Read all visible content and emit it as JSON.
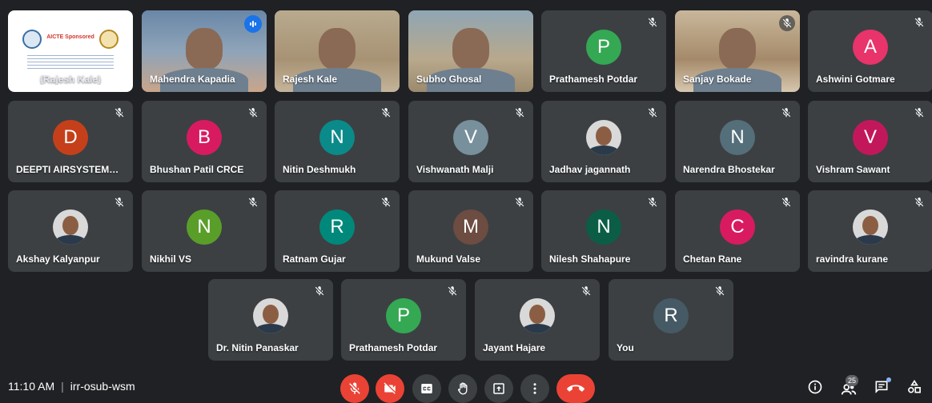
{
  "colors": {
    "accent": "#8ab4f8",
    "danger": "#ea4335",
    "tile": "#3c4043",
    "background": "#202124"
  },
  "participants": [
    {
      "name": "(Rajesh Kale)",
      "kind": "presentation",
      "presentation": {
        "line1": "AICTE Sponsored"
      }
    },
    {
      "name": "Mahendra Kapadia",
      "kind": "video",
      "speaking": true
    },
    {
      "name": "Rajesh Kale",
      "kind": "video"
    },
    {
      "name": "Subho Ghosal",
      "kind": "video"
    },
    {
      "name": "Prathamesh Potdar",
      "kind": "initial",
      "initial": "P",
      "color": "#34a853",
      "muted": true
    },
    {
      "name": "Sanjay Bokade",
      "kind": "video",
      "muted": true
    },
    {
      "name": "Ashwini Gotmare",
      "kind": "initial",
      "initial": "A",
      "color": "#e8336b",
      "muted": true
    },
    {
      "name": "DEEPTI AIRSYSTEMS P...",
      "kind": "initial",
      "initial": "D",
      "color": "#c5401a",
      "muted": true
    },
    {
      "name": "Bhushan Patil CRCE",
      "kind": "initial",
      "initial": "B",
      "color": "#d81b60",
      "muted": true
    },
    {
      "name": "Nitin Deshmukh",
      "kind": "initial",
      "initial": "N",
      "color": "#0b8a8a",
      "muted": true
    },
    {
      "name": "Vishwanath Malji",
      "kind": "initial",
      "initial": "V",
      "color": "#78909c",
      "muted": true
    },
    {
      "name": "Jadhav jagannath",
      "kind": "photo",
      "muted": true
    },
    {
      "name": "Narendra Bhostekar",
      "kind": "initial",
      "initial": "N",
      "color": "#546e7a",
      "muted": true
    },
    {
      "name": "Vishram Sawant",
      "kind": "initial",
      "initial": "V",
      "color": "#c2185b",
      "muted": true
    },
    {
      "name": "Akshay Kalyanpur",
      "kind": "photo",
      "muted": true
    },
    {
      "name": "Nikhil VS",
      "kind": "initial",
      "initial": "N",
      "color": "#5a9e2a",
      "muted": true
    },
    {
      "name": "Ratnam Gujar",
      "kind": "initial",
      "initial": "R",
      "color": "#00897b",
      "muted": true
    },
    {
      "name": "Mukund Valse",
      "kind": "initial",
      "initial": "M",
      "color": "#6d4c41",
      "muted": true
    },
    {
      "name": "Nilesh Shahapure",
      "kind": "initial",
      "initial": "N",
      "color": "#0b5e45",
      "muted": true
    },
    {
      "name": "Chetan Rane",
      "kind": "initial",
      "initial": "C",
      "color": "#d81b60",
      "muted": true
    },
    {
      "name": "ravindra kurane",
      "kind": "photo",
      "muted": true
    },
    {
      "name": "Dr. Nitin Panaskar",
      "kind": "photo",
      "muted": true
    },
    {
      "name": "Prathamesh Potdar",
      "kind": "initial",
      "initial": "P",
      "color": "#34a853",
      "muted": true
    },
    {
      "name": "Jayant Hajare",
      "kind": "photo",
      "muted": true
    },
    {
      "name": "You",
      "kind": "initial",
      "initial": "R",
      "color": "#455a64",
      "muted": true
    }
  ],
  "bottom_bar": {
    "time": "11:10 AM",
    "meeting_code": "irr-osub-wsm",
    "participant_count": "25"
  }
}
